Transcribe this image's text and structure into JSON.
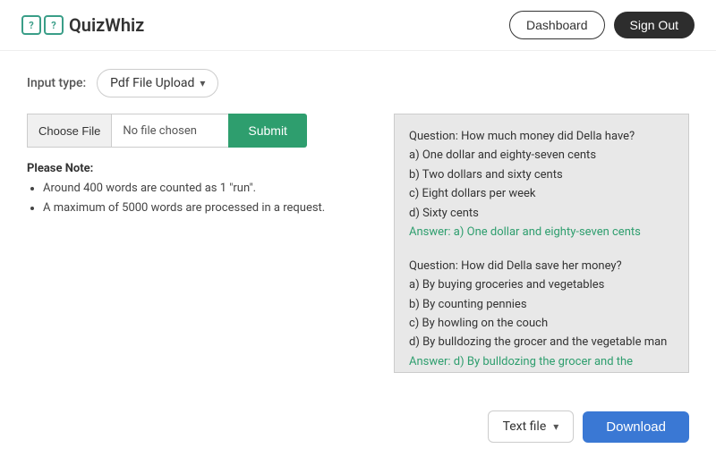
{
  "app": {
    "name": "QuizWhiz"
  },
  "header": {
    "dashboard_label": "Dashboard",
    "signout_label": "Sign Out"
  },
  "input_type": {
    "label": "Input type:",
    "selected": "Pdf File Upload"
  },
  "file_upload": {
    "choose_file_label": "Choose File",
    "file_name": "No file chosen",
    "submit_label": "Submit"
  },
  "notes": {
    "title": "Please Note:",
    "items": [
      "Around 400 words are counted as 1 \"run\".",
      "A maximum of 5000 words are processed in a request."
    ]
  },
  "quiz_output": {
    "blocks": [
      {
        "question": "Question: How much money did Della have?",
        "options": [
          "a) One dollar and eighty-seven cents",
          "b) Two dollars and sixty cents",
          "c) Eight dollars per week",
          "d) Sixty cents"
        ],
        "answer": "Answer: a) One dollar and eighty-seven cents"
      },
      {
        "question": "Question: How did Della save her money?",
        "options": [
          "a) By buying groceries and vegetables",
          "b) By counting pennies",
          "c) By howling on the couch",
          "d) By bulldozing the grocer and the vegetable man"
        ],
        "answer": "Answer: d) By bulldozing the grocer and the vegetable man"
      }
    ]
  },
  "bottom_bar": {
    "file_type_label": "Text file",
    "download_label": "Download"
  }
}
